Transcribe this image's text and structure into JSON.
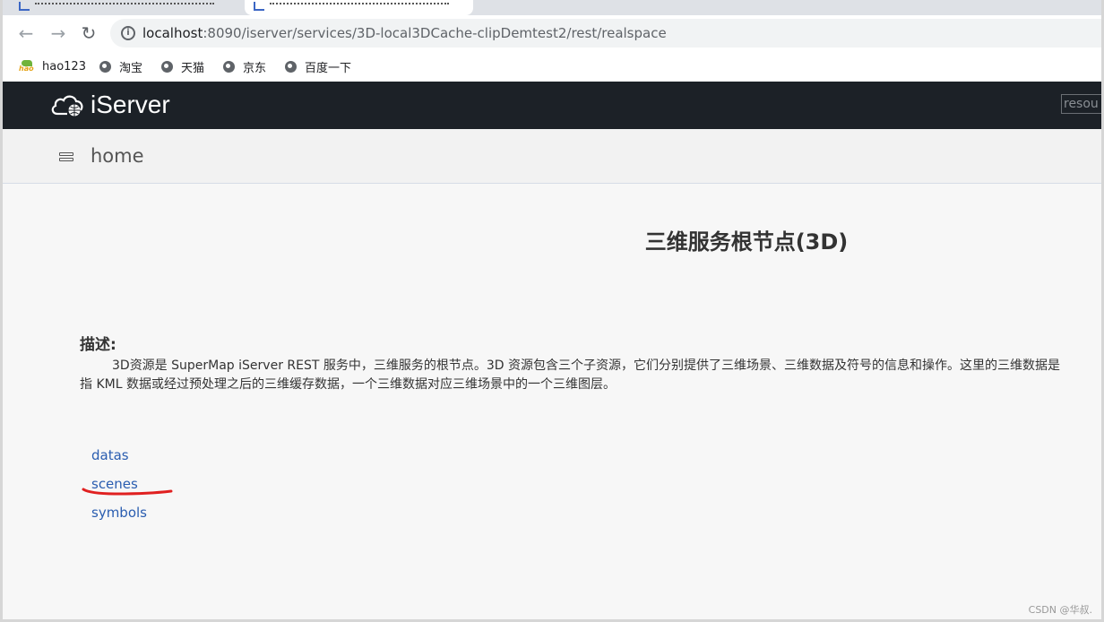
{
  "browser": {
    "url_host": "localhost",
    "url_path": ":8090/iserver/services/3D-local3DCache-clipDemtest2/rest/realspace",
    "bookmarks": [
      {
        "label": "hao123",
        "icon": "hao123-icon"
      },
      {
        "label": "淘宝",
        "icon": "globe-icon"
      },
      {
        "label": "天猫",
        "icon": "globe-icon"
      },
      {
        "label": "京东",
        "icon": "globe-icon"
      },
      {
        "label": "百度一下",
        "icon": "globe-icon"
      }
    ]
  },
  "header": {
    "logo_text": "iServer",
    "search_value": "resou"
  },
  "breadcrumb": {
    "label": "home"
  },
  "main": {
    "title": "三维服务根节点(3D)",
    "description_label": "描述:",
    "description": "3D资源是 SuperMap iServer REST 服务中，三维服务的根节点。3D 资源包含三个子资源，它们分别提供了三维场景、三维数据及符号的信息和操作。这里的三维数据是指 KML 数据或经过预处理之后的三维缓存数据，一个三维数据对应三维场景中的一个三维图层。",
    "links": [
      "datas",
      "scenes",
      "symbols"
    ]
  },
  "watermark": "CSDN @华叔.",
  "colors": {
    "topbar": "#1c2127",
    "link": "#2a5db0",
    "annotation": "#e02020"
  }
}
